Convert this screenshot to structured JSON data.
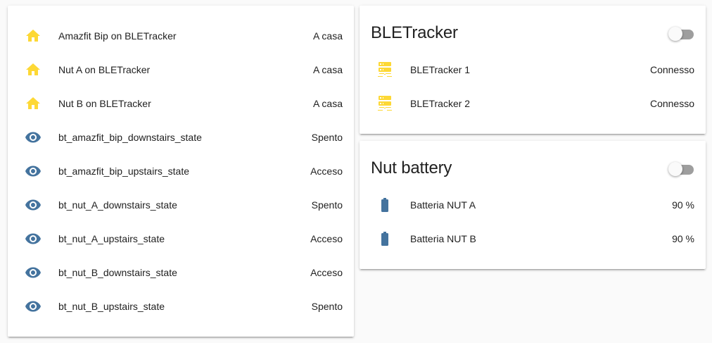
{
  "entities_card": {
    "rows": [
      {
        "icon": "home-icon",
        "name": "Amazfit Bip on BLETracker",
        "state": "A casa"
      },
      {
        "icon": "home-icon",
        "name": "Nut A on BLETracker",
        "state": "A casa"
      },
      {
        "icon": "home-icon",
        "name": "Nut B on BLETracker",
        "state": "A casa"
      },
      {
        "icon": "eye-icon",
        "name": "bt_amazfit_bip_downstairs_state",
        "state": "Spento"
      },
      {
        "icon": "eye-icon",
        "name": "bt_amazfit_bip_upstairs_state",
        "state": "Acceso"
      },
      {
        "icon": "eye-icon",
        "name": "bt_nut_A_downstairs_state",
        "state": "Spento"
      },
      {
        "icon": "eye-icon",
        "name": "bt_nut_A_upstairs_state",
        "state": "Acceso"
      },
      {
        "icon": "eye-icon",
        "name": "bt_nut_B_downstairs_state",
        "state": "Acceso"
      },
      {
        "icon": "eye-icon",
        "name": "bt_nut_B_upstairs_state",
        "state": "Spento"
      }
    ]
  },
  "bletracker_card": {
    "title": "BLETracker",
    "toggle_on": false,
    "rows": [
      {
        "icon": "server-icon",
        "name": "BLETracker 1",
        "state": "Connesso"
      },
      {
        "icon": "server-icon",
        "name": "BLETracker 2",
        "state": "Connesso"
      }
    ]
  },
  "battery_card": {
    "title": "Nut battery",
    "toggle_on": false,
    "rows": [
      {
        "icon": "battery-icon",
        "name": "Batteria NUT A",
        "state": "90 %"
      },
      {
        "icon": "battery-icon",
        "name": "Batteria NUT B",
        "state": "90 %"
      }
    ]
  },
  "colors": {
    "home_icon": "#fdd835",
    "eye_icon": "#44739e",
    "server_icon": "#fdd835",
    "battery_icon": "#44739e",
    "toggle_track": "#9e9e9e",
    "toggle_thumb": "#fafafa"
  }
}
